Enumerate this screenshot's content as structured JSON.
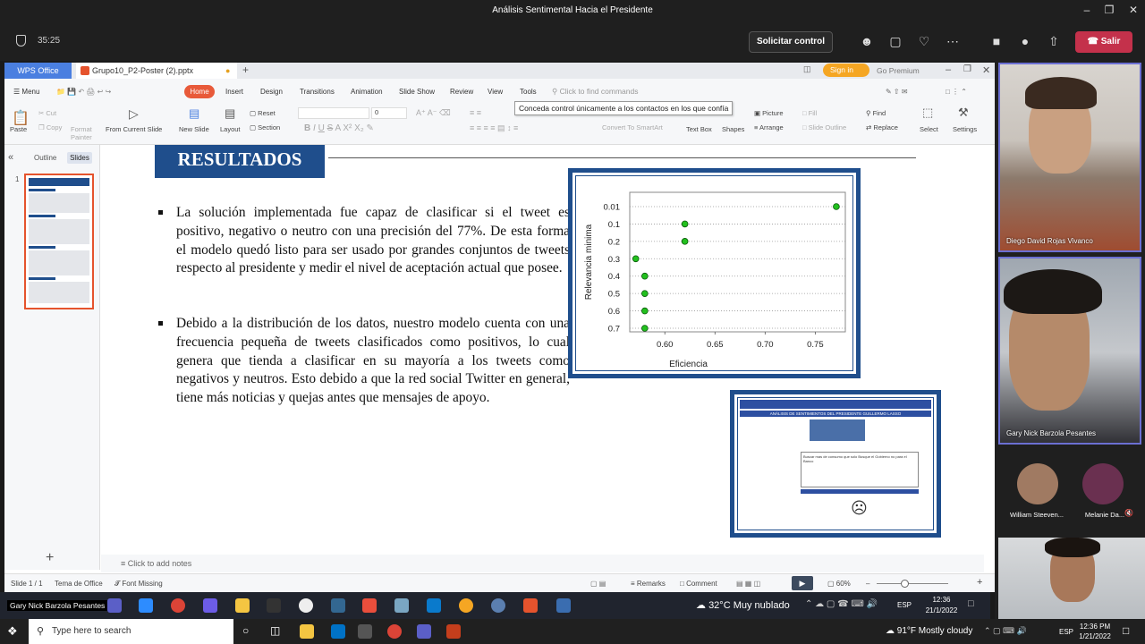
{
  "window": {
    "title": "Análisis Sentimental Hacia el Presidente"
  },
  "meeting": {
    "timer": "35:25",
    "request_control": "Solicitar control",
    "leave": "Salir",
    "participants": [
      {
        "name": "Diego David Rojas Vivanco"
      },
      {
        "name": "Gary Nick Barzola Pesantes"
      }
    ],
    "small_participants": [
      {
        "name": "William Steeven..."
      },
      {
        "name": "Melanie Da..."
      }
    ]
  },
  "wps": {
    "app_tab": "WPS Office",
    "file_tab": "Grupo10_P2-Poster (2).pptx",
    "sign_in": "Sign in",
    "premium": "Go Premium",
    "menu": [
      "Menu",
      "Home",
      "Insert",
      "Design",
      "Transitions",
      "Animation",
      "Slide Show",
      "Review",
      "View",
      "Tools"
    ],
    "find_placeholder": "Click to find commands",
    "ribbon": {
      "paste": "Paste",
      "cut": "Cut",
      "copy": "Copy",
      "format_painter": "Format Painter",
      "from_current": "From Current Slide",
      "new_slide": "New Slide",
      "layout": "Layout",
      "reset": "Reset",
      "section": "Section",
      "font_size": "0",
      "convert": "Convert To SmartArt",
      "text_box": "Text Box",
      "shapes": "Shapes",
      "picture": "Picture",
      "fill": "Fill",
      "arrange": "Arrange",
      "outline": "Slide Outline",
      "find": "Find",
      "replace": "Replace",
      "select": "Select",
      "settings": "Settings"
    },
    "tooltip": "Conceda control únicamente a los contactos en los que confía",
    "pane_tabs": [
      "Outline",
      "Slides"
    ],
    "slide_number": "1",
    "notes_placeholder": "Click to add notes",
    "status": {
      "slide": "Slide 1 / 1",
      "theme": "Tema de Office",
      "font_missing": "Font Missing",
      "remarks": "Remarks",
      "comment": "Comment",
      "zoom": "60%"
    }
  },
  "slide": {
    "heading": "RESULTADOS",
    "bullets": [
      "La solución implementada fue capaz de clasificar si el tweet es positivo, negativo o neutro con una precisión del 77%. De esta forma el modelo quedó listo para ser usado por grandes conjuntos de tweets respecto al presidente y medir el nivel de aceptación actual que posee.",
      "Debido a la distribución de los datos, nuestro modelo cuenta con una frecuencia pequeña de tweets clasificados como positivos, lo cual genera que tienda a clasificar en su mayoría a los tweets como negativos y neutros. Esto debido a que la red social Twitter en general, tiene más noticias y quejas antes que mensajes de apoyo."
    ],
    "app_preview": {
      "title": "ANÁLISIS DE SENTIMIENTOS DEL PRESIDENTE GUILLERMO LASSO",
      "tweet": "Buscar mas de consumo que solo Busque el Gobierno no para el Banco"
    }
  },
  "chart_data": {
    "type": "scatter",
    "xlabel": "Eficiencia",
    "ylabel": "Relevancia minima",
    "categories": [
      "0.01",
      "0.1",
      "0.2",
      "0.3",
      "0.4",
      "0.5",
      "0.6",
      "0.7"
    ],
    "x_ticks": [
      "0.60",
      "0.65",
      "0.70",
      "0.75"
    ],
    "xlim": [
      0.565,
      0.78
    ],
    "points": [
      {
        "y": "0.01",
        "x": 0.771
      },
      {
        "y": "0.1",
        "x": 0.62
      },
      {
        "y": "0.2",
        "x": 0.62
      },
      {
        "y": "0.3",
        "x": 0.571
      },
      {
        "y": "0.4",
        "x": 0.58
      },
      {
        "y": "0.5",
        "x": 0.58
      },
      {
        "y": "0.6",
        "x": 0.58
      },
      {
        "y": "0.7",
        "x": 0.58
      }
    ],
    "point_color": "#22c01e",
    "grid": "horizontal dotted"
  },
  "rdp_taskbar": {
    "user": "Gary Nick Barzola Pesantes",
    "weather": "32°C  Muy nublado",
    "lang": "ESP",
    "time": "12:36",
    "date": "21/1/2022"
  },
  "win_taskbar": {
    "search": "Type here to search",
    "weather": "91°F  Mostly cloudy",
    "lang": "ESP",
    "time": "12:36 PM",
    "date": "1/21/2022"
  }
}
